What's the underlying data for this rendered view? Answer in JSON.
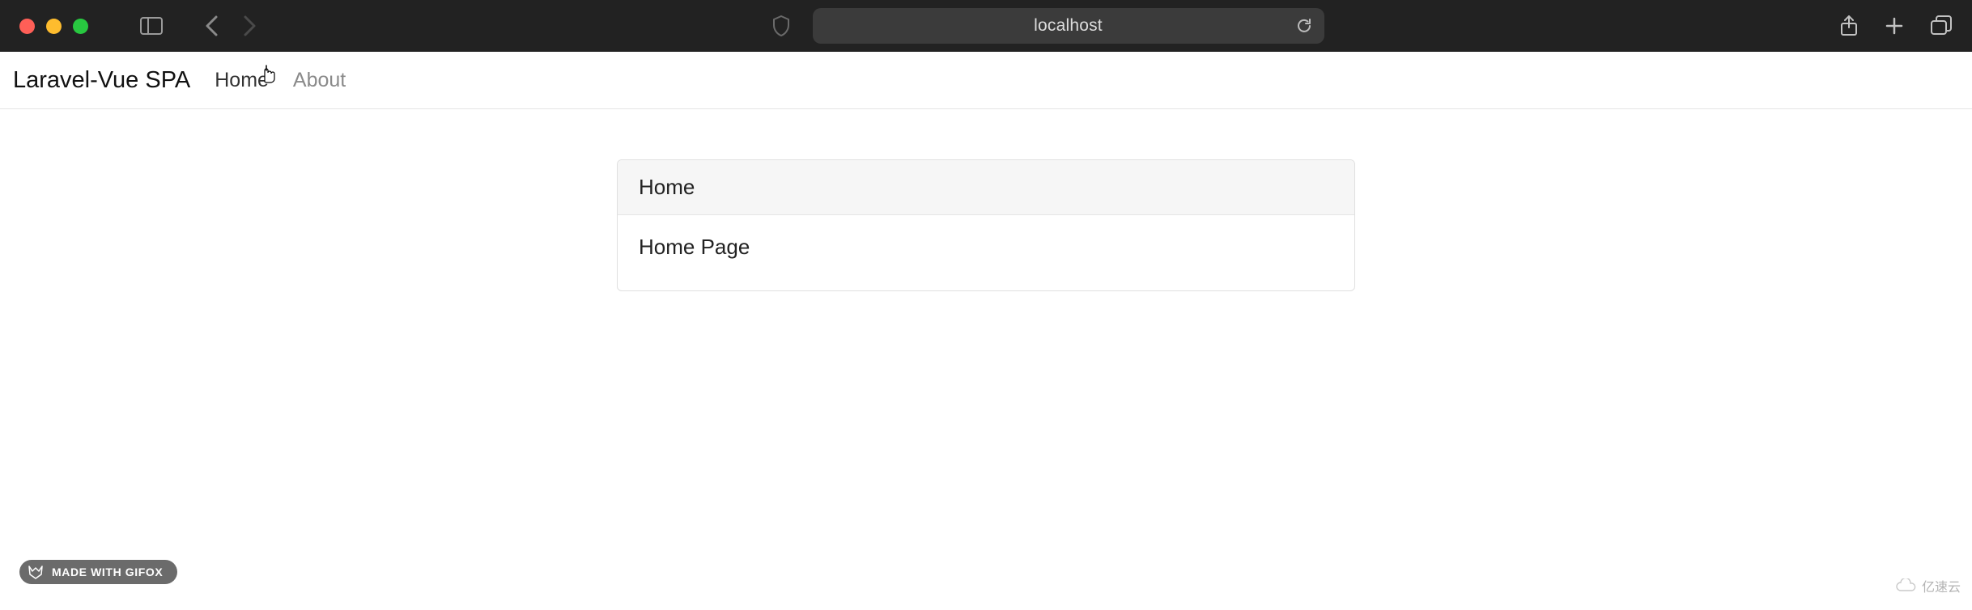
{
  "browser": {
    "address": "localhost"
  },
  "navbar": {
    "brand": "Laravel-Vue SPA",
    "links": [
      {
        "label": "Home"
      },
      {
        "label": "About"
      }
    ]
  },
  "card": {
    "title": "Home",
    "body": "Home Page"
  },
  "badge": {
    "text": "MADE WITH GIFOX"
  },
  "watermark": {
    "text": "亿速云"
  }
}
